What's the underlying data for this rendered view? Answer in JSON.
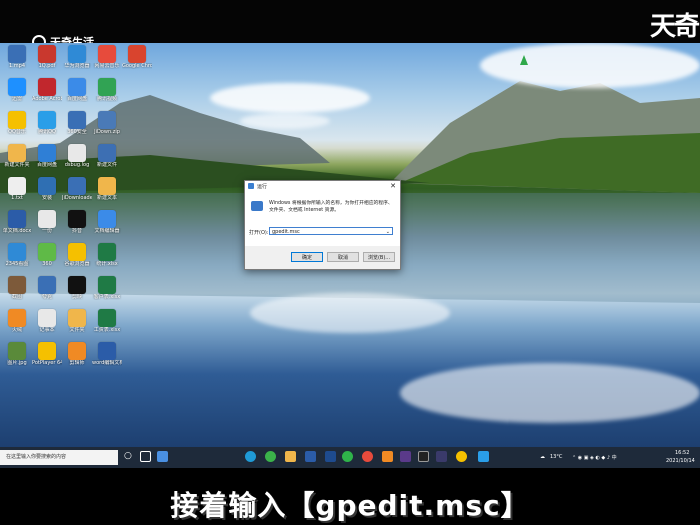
{
  "brand": {
    "left": "天奇生活",
    "right": "天奇"
  },
  "desktop_icons": [
    {
      "label": "1.mp4",
      "color": "#3a6fb5"
    },
    {
      "label": "1Q.pdf",
      "color": "#c9382e"
    },
    {
      "label": "华为浏览器",
      "color": "#2f8ad6"
    },
    {
      "label": "网易云音乐",
      "color": "#e74b3c"
    },
    {
      "label": "Google Chrome",
      "color": "#d9442e"
    },
    {
      "label": "迅雷",
      "color": "#1e90ff"
    },
    {
      "label": "Adobe Acrobat",
      "color": "#c1272d"
    },
    {
      "label": "百度网盘",
      "color": "#3b8be8"
    },
    {
      "label": "腾讯视频",
      "color": "#31a354"
    },
    {
      "label": "QQ音乐",
      "color": "#f5c000"
    },
    {
      "label": "腾讯QQ",
      "color": "#2a9ee8"
    },
    {
      "label": "360安全",
      "color": "#3a6fb5"
    },
    {
      "label": "JiDown.zip",
      "color": "#4a7ab7"
    },
    {
      "label": "新建文件夹",
      "color": "#f0b64b"
    },
    {
      "label": "百度网盘",
      "color": "#2f7fd6"
    },
    {
      "label": "dsbug.log",
      "color": "#e8e8e8"
    },
    {
      "label": "新建文件",
      "color": "#3d6fb3"
    },
    {
      "label": "1.txt",
      "color": "#eeeeee"
    },
    {
      "label": "安装",
      "color": "#2f6fb3"
    },
    {
      "label": "JiDownloader",
      "color": "#3a6fb5"
    },
    {
      "label": "新建文本",
      "color": "#f0b64b"
    },
    {
      "label": "单文档.docx",
      "color": "#2b5ca8"
    },
    {
      "label": "一份",
      "color": "#e8e8e8"
    },
    {
      "label": "抖音",
      "color": "#111111"
    },
    {
      "label": "文档编辑器",
      "color": "#3b8be8"
    },
    {
      "label": "2345看图",
      "color": "#2f8ad6"
    },
    {
      "label": "360",
      "color": "#5fba47"
    },
    {
      "label": "谷歌浏览器",
      "color": "#f5c000"
    },
    {
      "label": "统计.xlsx",
      "color": "#1f7a45"
    },
    {
      "label": "截图",
      "color": "#7d5a3a"
    },
    {
      "label": "夸克",
      "color": "#3a6fb5"
    },
    {
      "label": "剪映",
      "color": "#111111"
    },
    {
      "label": "客户表.xlsx",
      "color": "#1f7a45"
    },
    {
      "label": "火绒",
      "color": "#f08a24"
    },
    {
      "label": "记事本",
      "color": "#e8e8e8"
    },
    {
      "label": "文件夹",
      "color": "#f0b64b"
    },
    {
      "label": "工资表.xlsx",
      "color": "#1f7a45"
    },
    {
      "label": "图片.jpg",
      "color": "#5a8a3a"
    },
    {
      "label": "PotPlayer 64 bit",
      "color": "#f5c000"
    },
    {
      "label": "剪辑师",
      "color": "#f08a24"
    },
    {
      "label": "word编辑文档.docx",
      "color": "#2b5ca8"
    }
  ],
  "run_dialog": {
    "title": "运行",
    "close": "✕",
    "description": "Windows 将根据你所输入的名称，为你打开相应的程序、文件夹、文档或 Internet 资源。",
    "open_label": "打开(O):",
    "open_value": "gpedit.msc",
    "ok": "确定",
    "cancel": "取消",
    "browse": "浏览(B)..."
  },
  "taskbar": {
    "search_placeholder": "在这里输入你要搜索的内容",
    "weather": "13°C",
    "time": "16:52",
    "date": "2021/10/14"
  },
  "caption": "接着输入【gpedit.msc】"
}
